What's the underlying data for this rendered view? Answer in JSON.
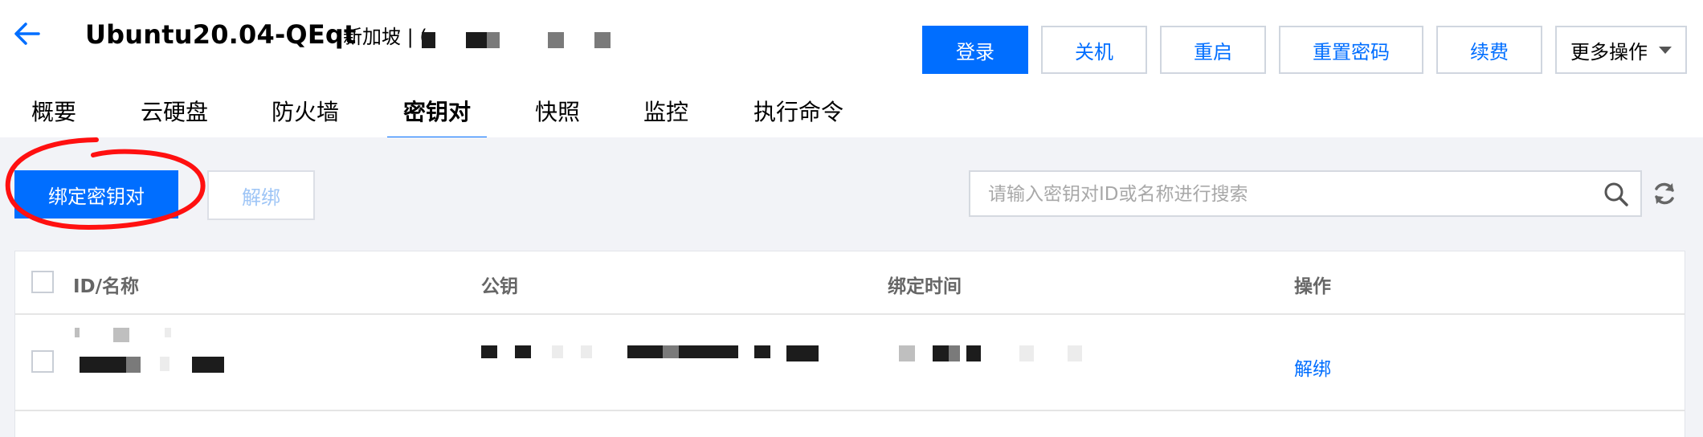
{
  "header": {
    "title": "Ubuntu20.04-QEqt",
    "region": "新加坡 | (",
    "buttons": {
      "login": "登录",
      "shutdown": "关机",
      "restart": "重启",
      "reset_password": "重置密码",
      "renew": "续费",
      "more": "更多操作"
    }
  },
  "tabs": [
    {
      "label": "概要"
    },
    {
      "label": "云硬盘"
    },
    {
      "label": "防火墙"
    },
    {
      "label": "密钥对",
      "active": true
    },
    {
      "label": "快照"
    },
    {
      "label": "监控"
    },
    {
      "label": "执行命令"
    }
  ],
  "toolbar": {
    "bind_label": "绑定密钥对",
    "unbind_label": "解绑",
    "search_placeholder": "请输入密钥对ID或名称进行搜索"
  },
  "table": {
    "columns": {
      "id_name": "ID/名称",
      "public_key": "公钥",
      "bind_time": "绑定时间",
      "actions": "操作"
    },
    "rows": [
      {
        "action_label": "解绑"
      }
    ]
  },
  "colors": {
    "primary": "#006eff",
    "highlight_circle": "#ff1010",
    "content_bg": "#f2f3f7"
  },
  "icons": [
    "back-arrow-icon",
    "search-icon",
    "refresh-icon",
    "caret-down-icon"
  ]
}
